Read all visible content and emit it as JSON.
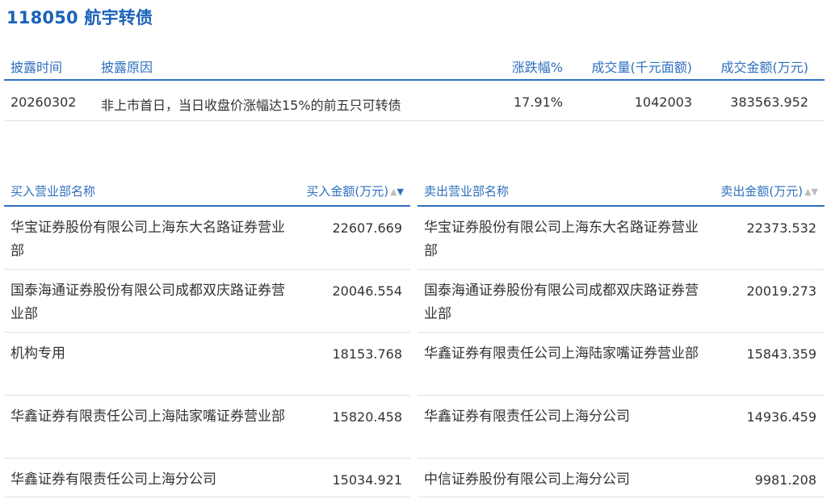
{
  "title": "118050 航宇转债",
  "summary": {
    "headers": {
      "date": "披露时间",
      "reason": "披露原因",
      "pct": "涨跌幅%",
      "vol": "成交量(千元面额)",
      "amt": "成交金额(万元)"
    },
    "row": {
      "date": "20260302",
      "reason": "非上市首日，当日收盘价涨幅达15%的前五只可转债",
      "pct": "17.91%",
      "vol": "1042003",
      "amt": "383563.952"
    }
  },
  "buy": {
    "header_name": "买入营业部名称",
    "header_amt": "买入金额(万元)",
    "rows": [
      {
        "name": "华宝证券股份有限公司上海东大名路证券营业部",
        "amt": "22607.669"
      },
      {
        "name": "国泰海通证券股份有限公司成都双庆路证券营业部",
        "amt": "20046.554"
      },
      {
        "name": "机构专用",
        "amt": "18153.768"
      },
      {
        "name": "华鑫证券有限责任公司上海陆家嘴证券营业部",
        "amt": "15820.458"
      },
      {
        "name": "华鑫证券有限责任公司上海分公司",
        "amt": "15034.921"
      }
    ]
  },
  "sell": {
    "header_name": "卖出营业部名称",
    "header_amt": "卖出金额(万元)",
    "rows": [
      {
        "name": "华宝证券股份有限公司上海东大名路证券营业部",
        "amt": "22373.532"
      },
      {
        "name": "国泰海通证券股份有限公司成都双庆路证券营业部",
        "amt": "20019.273"
      },
      {
        "name": "华鑫证券有限责任公司上海陆家嘴证券营业部",
        "amt": "15843.359"
      },
      {
        "name": "华鑫证券有限责任公司上海分公司",
        "amt": "14936.459"
      },
      {
        "name": "中信证券股份有限公司上海分公司",
        "amt": "9981.208"
      }
    ]
  },
  "icons": {
    "sort_up": "▲",
    "sort_down": "▼"
  },
  "colors": {
    "accent": "#2f6fbf",
    "title": "#1a62b8",
    "text": "#333333",
    "divider": "#e2e2e2"
  }
}
